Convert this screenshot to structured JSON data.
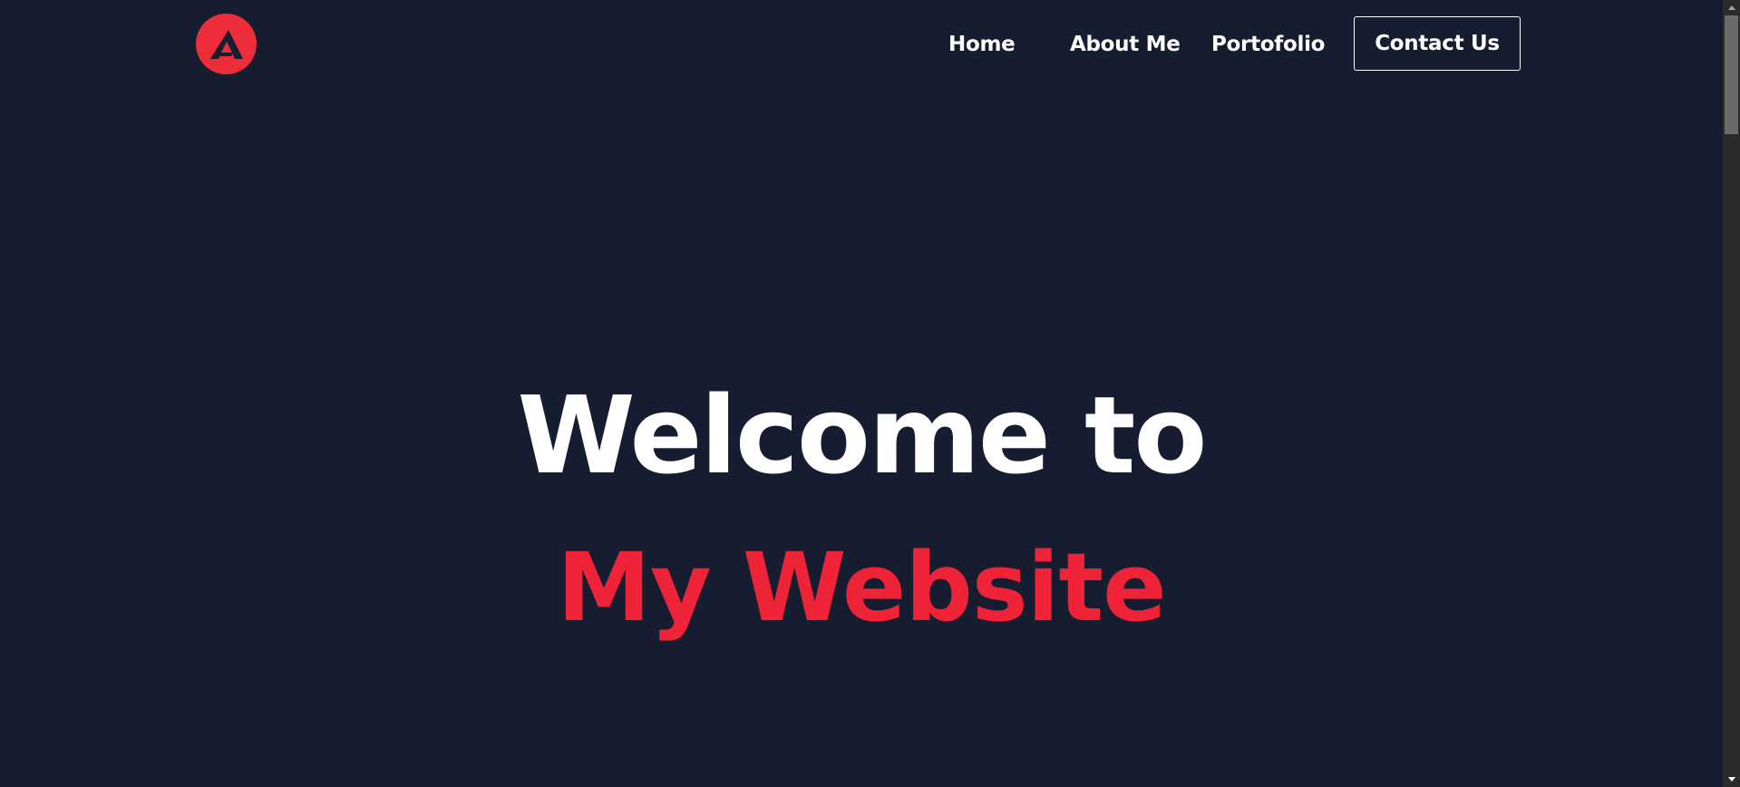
{
  "colors": {
    "background": "#161d30",
    "accent": "#ee2337",
    "logo": "#ee2d3b",
    "text": "#ffffff"
  },
  "logo": {
    "icon": "a-logo-icon"
  },
  "nav": {
    "items": [
      {
        "label": "Home"
      },
      {
        "label": "About Me"
      },
      {
        "label": "Portofolio"
      }
    ],
    "cta_label": "Contact Us"
  },
  "hero": {
    "line1": "Welcome to",
    "line2": "My Website"
  }
}
